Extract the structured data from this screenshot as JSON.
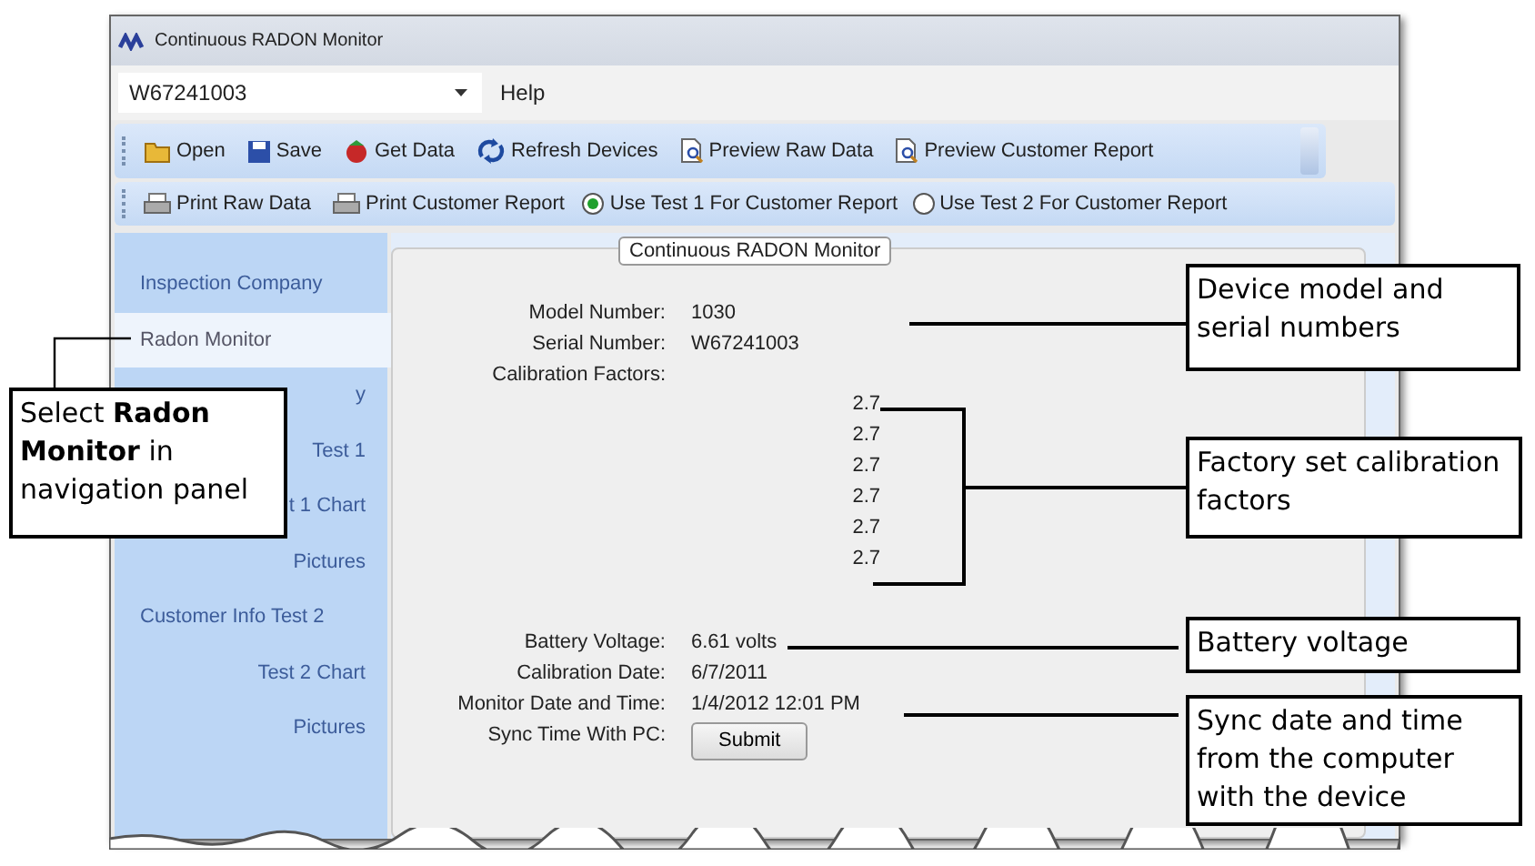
{
  "window": {
    "title": "Continuous RADON Monitor"
  },
  "menu": {
    "device": "W67241003",
    "items": [
      "Help"
    ]
  },
  "toolbar_1": [
    {
      "kind": "open",
      "label": "Open"
    },
    {
      "kind": "save",
      "label": "Save"
    },
    {
      "kind": "get",
      "label": "Get Data"
    },
    {
      "kind": "refresh",
      "label": "Refresh Devices"
    },
    {
      "kind": "preview",
      "label": "Preview Raw Data"
    },
    {
      "kind": "preview",
      "label": "Preview Customer Report"
    }
  ],
  "toolbar_2": [
    {
      "kind": "print",
      "label": "Print Raw Data"
    },
    {
      "kind": "print",
      "label": "Print Customer Report"
    },
    {
      "kind": "radio",
      "label": "Use Test 1 For Customer Report",
      "selected": true
    },
    {
      "kind": "radio",
      "label": "Use Test 2 For Customer Report",
      "selected": false
    }
  ],
  "sidebar": {
    "items": [
      {
        "kind": "section",
        "label": "Inspection Company",
        "selected": false
      },
      {
        "kind": "section",
        "label": "Radon Monitor",
        "selected": true
      },
      {
        "kind": "sub",
        "label": "y",
        "selected": false
      },
      {
        "kind": "sub",
        "label": "Test 1",
        "selected": false
      },
      {
        "kind": "sub",
        "label": "t 1 Chart",
        "selected": false
      },
      {
        "kind": "sub",
        "label": "Pictures",
        "selected": false
      },
      {
        "kind": "section",
        "label": "Customer Info Test 2",
        "selected": false
      },
      {
        "kind": "sub",
        "label": "Test 2 Chart",
        "selected": false
      },
      {
        "kind": "sub",
        "label": "Pictures",
        "selected": false
      }
    ]
  },
  "panel": {
    "title": "Continuous RADON Monitor",
    "fields": [
      {
        "label": "Model Number:",
        "value": "1030"
      },
      {
        "label": "Serial Number:",
        "value": "W67241003"
      },
      {
        "label": "Calibration Factors:"
      }
    ],
    "calibration_factors": [
      "2.7",
      "2.7",
      "2.7",
      "2.7",
      "2.7",
      "2.7"
    ],
    "fields_2": [
      {
        "label": "Battery Voltage:",
        "value": "6.61 volts"
      },
      {
        "label": "Calibration Date:",
        "value": "6/7/2011"
      },
      {
        "label": "Monitor Date and Time:",
        "value": "1/4/2012 12:01 PM"
      },
      {
        "label": "Sync Time With PC:",
        "button": "Submit"
      }
    ]
  },
  "callouts": [
    "Select **Radon Monitor** in navigation panel",
    "Device model and serial numbers",
    "Factory set calibration factors",
    "Battery voltage",
    "Sync date and time from the computer with the device"
  ]
}
